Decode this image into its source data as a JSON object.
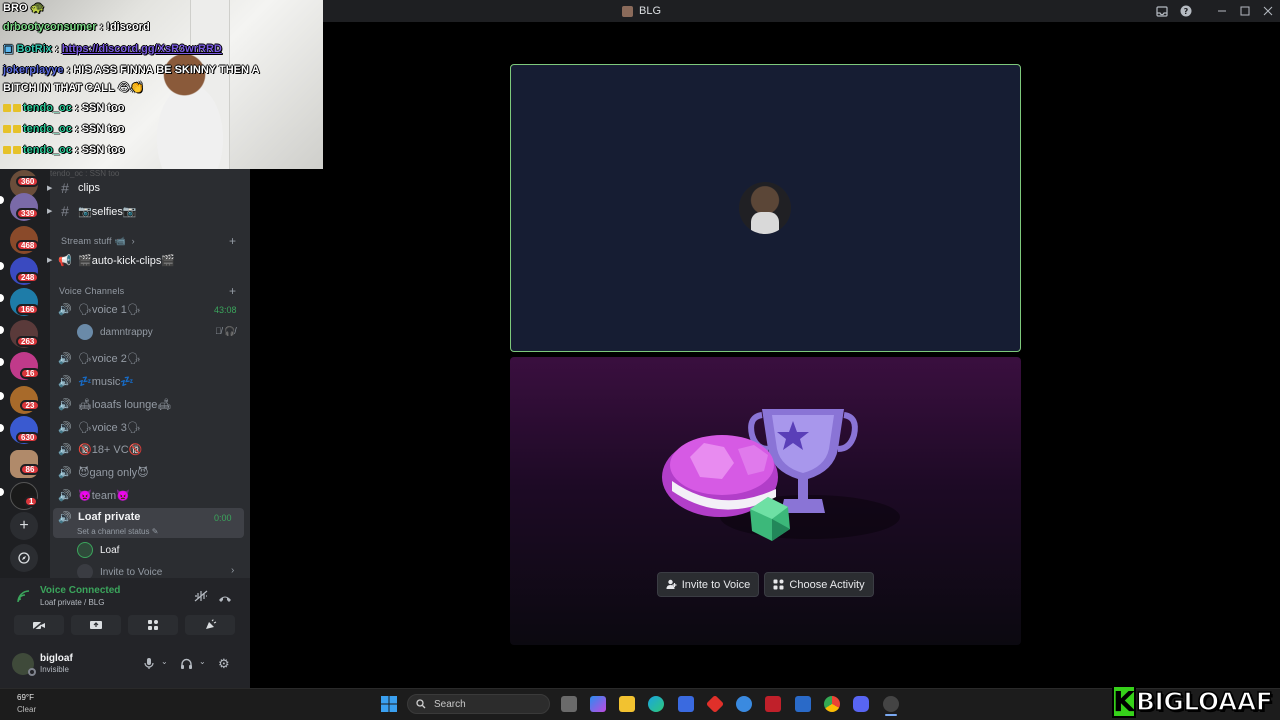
{
  "window": {
    "title": "BLG"
  },
  "overlay_chat": [
    {
      "user": "",
      "badge": "",
      "message": "BRO 🐢"
    },
    {
      "user": "drbootyconsumer",
      "badge": "",
      "message": " : !discord"
    },
    {
      "user": "BotRix",
      "badge": "bot",
      "message": " : ",
      "link": "https://discord.gg/XsR3wrRRD"
    },
    {
      "user": "jokerplayye",
      "badge": "",
      "message": " : HIS ASS FINNA BE SKINNY THEN A"
    },
    {
      "user": "",
      "badge": "",
      "message": "BITCH IN THAT CALL 😂👏"
    },
    {
      "user": "tendo_oc",
      "badge": "sub",
      "message": " : SSN too"
    },
    {
      "user": "tendo_oc",
      "badge": "sub",
      "message": " : SSN too"
    },
    {
      "user": "tendo_oc",
      "badge": "sub",
      "message": " : SSN too"
    },
    {
      "user": "tendo_oc",
      "badge": "",
      "message": " : SSN too"
    }
  ],
  "server_badges": [
    "360",
    "339",
    "468",
    "248",
    "166",
    "263",
    "16",
    "23",
    "630",
    "86",
    "1"
  ],
  "channels": {
    "text": [
      {
        "name": "clips"
      },
      {
        "name": "📷selfies📷"
      }
    ],
    "stream_category": "Stream stuff 📹",
    "stream_channels": [
      {
        "name": "🎬auto-kick-clips🎬"
      }
    ],
    "voice_category": "Voice Channels",
    "voice": [
      {
        "name": "🗣voice 1🗣",
        "timer": "43:08"
      },
      {
        "name": "🗣voice 2🗣"
      },
      {
        "name": "💤music💤"
      },
      {
        "name": "🛋loaafs lounge🛋"
      },
      {
        "name": "🗣voice 3🗣"
      },
      {
        "name": "🔞18+ VC🔞"
      },
      {
        "name": "😈gang only😈"
      },
      {
        "name": "👿team👿"
      }
    ],
    "voice1_member": "damntrappy",
    "private": {
      "name": "Loaf private",
      "timer": "0:00",
      "status_prompt": "Set a channel status",
      "member": "Loaf",
      "invite": "Invite to Voice"
    }
  },
  "voice_panel": {
    "status": "Voice Connected",
    "location": "Loaf private / BLG"
  },
  "user_panel": {
    "name": "bigloaf",
    "status": "Invisible"
  },
  "stage": {
    "invite_label": "Invite to Voice",
    "activity_label": "Choose Activity"
  },
  "taskbar": {
    "weather_temp": "69°F",
    "weather_desc": "Clear",
    "search_placeholder": "Search"
  },
  "brand": {
    "letter": "K",
    "name": "BIGLOAAF"
  },
  "colors": {
    "accent_green": "#3ba55c",
    "tile_border": "#7ec97c",
    "badge_red": "#da373c",
    "kick_green": "#36d11a"
  }
}
